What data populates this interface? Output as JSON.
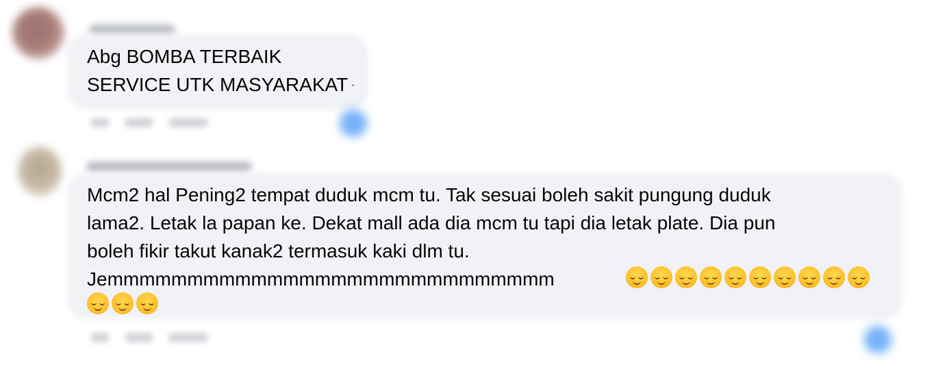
{
  "comments": [
    {
      "author": "",
      "lines": [
        "Abg BOMBA TERBAIK",
        "SERVICE UTK MASYARAKAT"
      ],
      "emoji_count": 0,
      "actions": {
        "time": "",
        "like": "",
        "reply": ""
      }
    },
    {
      "author": "",
      "lines": [
        "Mcm2 hal Pening2 tempat duduk mcm tu. Tak sesuai boleh sakit pungung duduk",
        "lama2. Letak la papan ke. Dekat mall ada dia mcm tu tapi dia letak plate. Dia pun",
        "boleh fikir takut kanak2 termasuk kaki dlm tu.",
        "Jemmmmmmmmmmmmmmmmmmmmmmmmmmmm"
      ],
      "emoji_name": "smiling-face-with-halo-icon",
      "emoji_count": 13,
      "actions": {
        "time": "",
        "like": "",
        "reply": ""
      }
    }
  ],
  "colors": {
    "bubble_bg": "#f0f2f5",
    "text": "#050505",
    "reaction_blue": "#5ba4f7"
  }
}
